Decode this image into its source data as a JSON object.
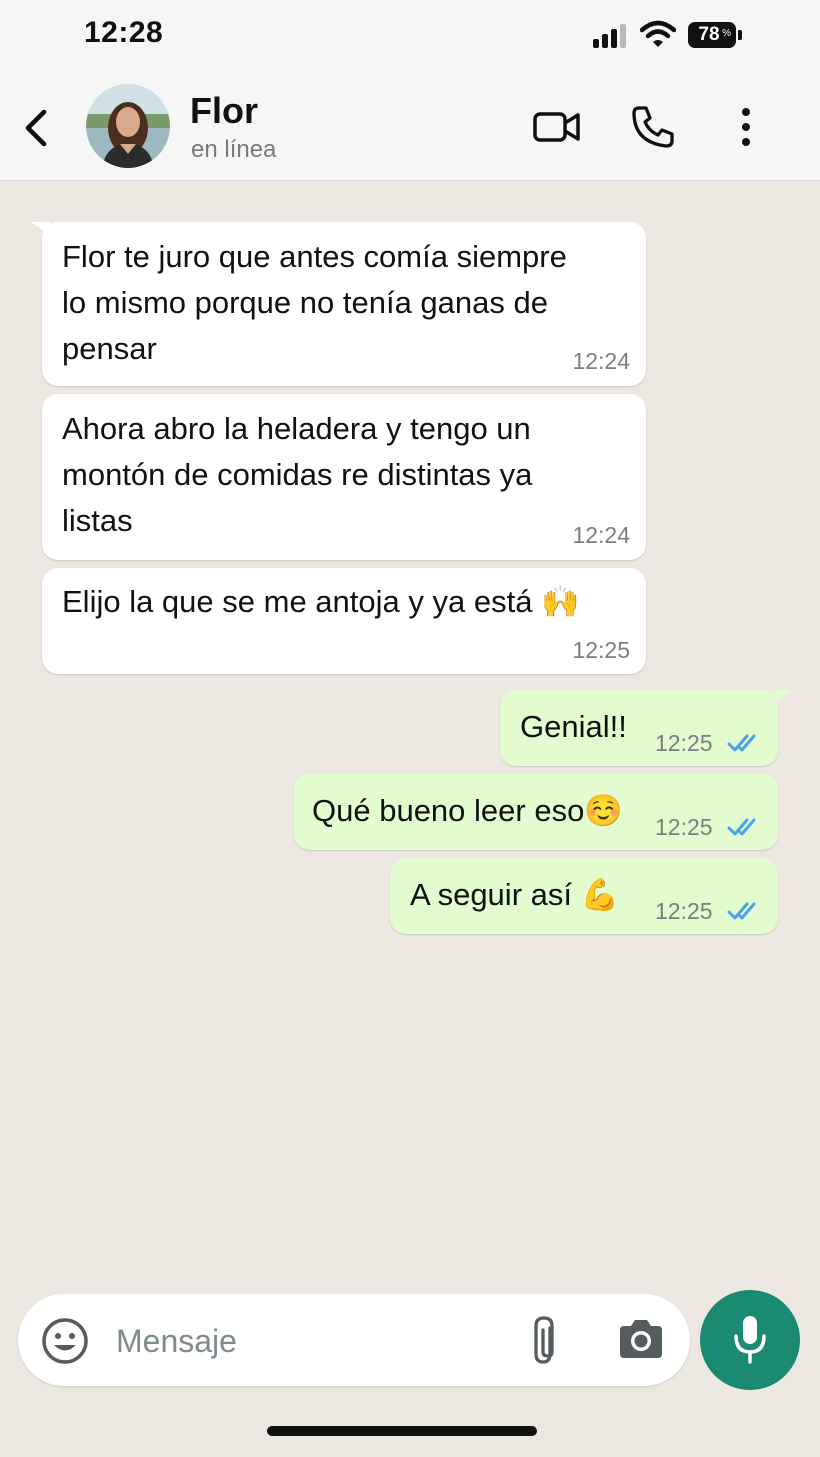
{
  "status_bar": {
    "time": "12:28",
    "battery": "78",
    "battery_symbol": "%"
  },
  "header": {
    "contact_name": "Flor",
    "contact_status": "en línea",
    "icons": [
      "back-chevron-icon",
      "video-call-icon",
      "phone-call-icon",
      "more-options-icon"
    ]
  },
  "messages": [
    {
      "direction": "in",
      "text": "Flor te juro que antes comía siempre\nlo mismo porque no tenía ganas de\npensar",
      "time": "12:24"
    },
    {
      "direction": "in",
      "text": "Ahora abro la heladera y tengo un\nmontón de comidas re distintas ya\nlistas",
      "time": "12:24"
    },
    {
      "direction": "in",
      "text": "Elijo la que se me antoja y ya está 🙌",
      "time": "12:25"
    },
    {
      "direction": "out",
      "text": "Genial!!",
      "time": "12:25",
      "read": true
    },
    {
      "direction": "out",
      "text": "Qué bueno leer eso☺️",
      "time": "12:25",
      "read": true
    },
    {
      "direction": "out",
      "text": "A seguir así 💪",
      "time": "12:25",
      "read": true
    }
  ],
  "composer": {
    "placeholder": "Mensaje",
    "icons": [
      "emoji-icon",
      "attach-icon",
      "camera-icon",
      "microphone-icon"
    ]
  },
  "colors": {
    "chat_background": "#ece7e1",
    "incoming_bubble": "#ffffff",
    "outgoing_bubble": "#e3fccf",
    "read_ticks": "#4aa3e8",
    "mic_button": "#1b8a73"
  }
}
